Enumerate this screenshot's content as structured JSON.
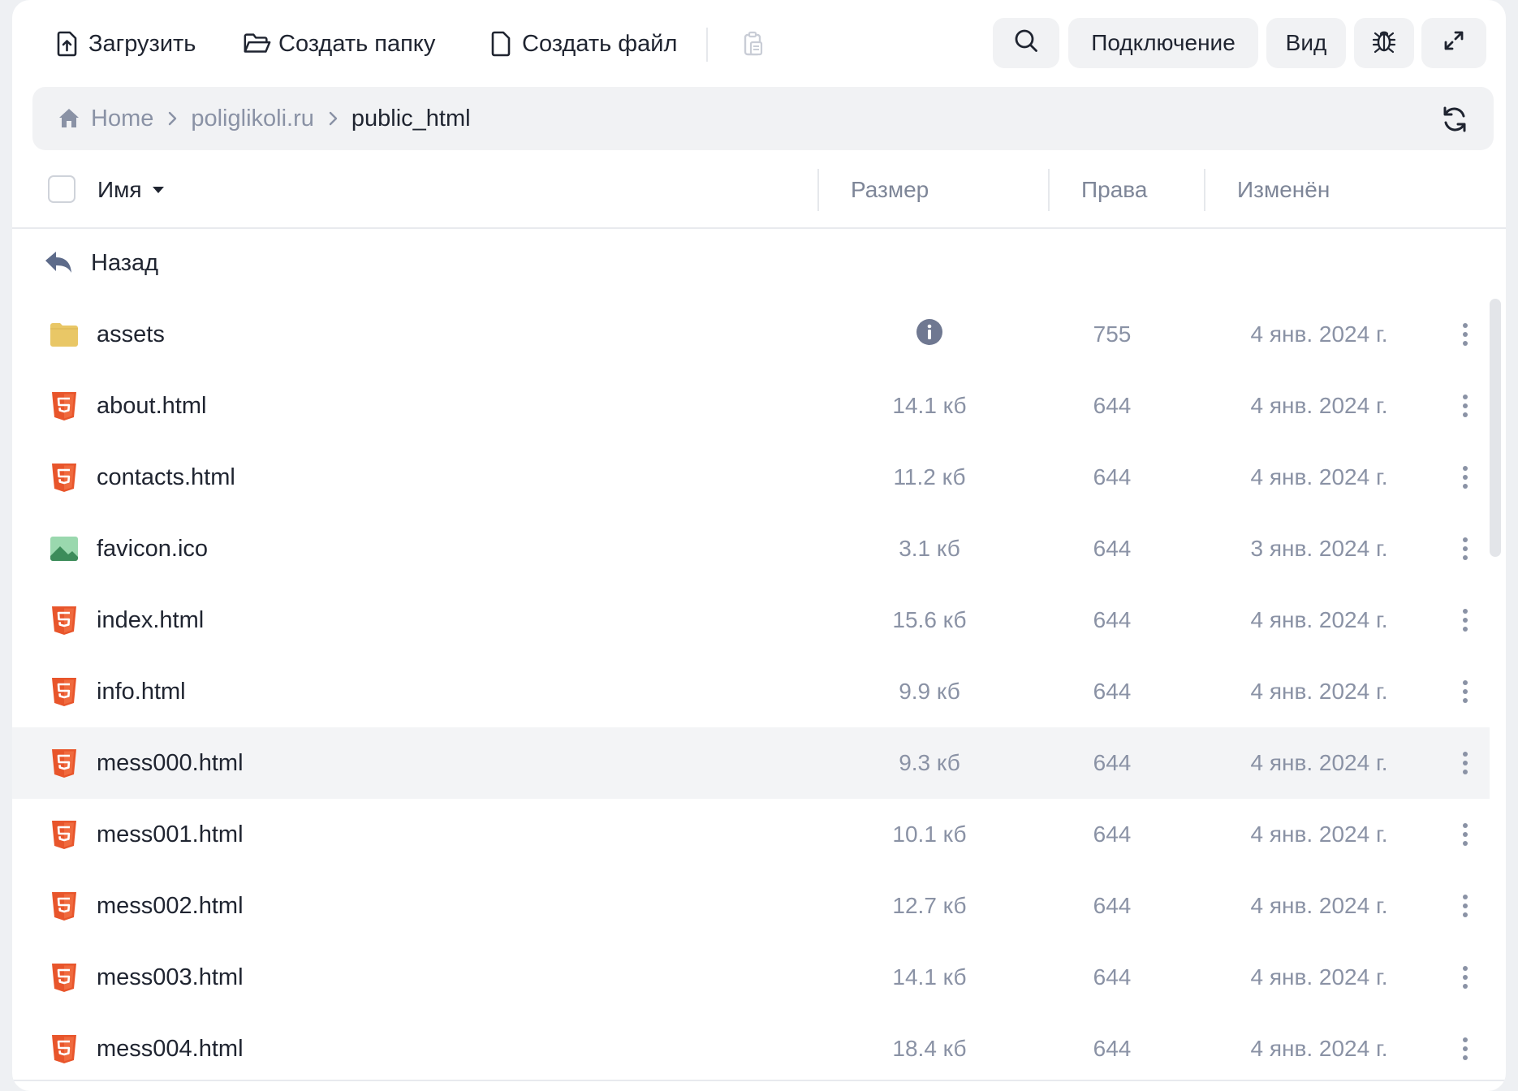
{
  "toolbar": {
    "upload_label": "Загрузить",
    "new_folder_label": "Создать папку",
    "new_file_label": "Создать файл",
    "connection_label": "Подключение",
    "view_label": "Вид"
  },
  "breadcrumb": {
    "items": [
      "Home",
      "poliglikoli.ru",
      "public_html"
    ]
  },
  "table": {
    "columns": {
      "name": "Имя",
      "size": "Размер",
      "perms": "Права",
      "modified": "Изменён"
    },
    "back_label": "Назад",
    "rows": [
      {
        "name": "assets",
        "type": "folder",
        "size": "",
        "perms": "755",
        "modified": "4 янв. 2024 г."
      },
      {
        "name": "about.html",
        "type": "html",
        "size": "14.1 кб",
        "perms": "644",
        "modified": "4 янв. 2024 г."
      },
      {
        "name": "contacts.html",
        "type": "html",
        "size": "11.2 кб",
        "perms": "644",
        "modified": "4 янв. 2024 г."
      },
      {
        "name": "favicon.ico",
        "type": "image",
        "size": "3.1 кб",
        "perms": "644",
        "modified": "3 янв. 2024 г."
      },
      {
        "name": "index.html",
        "type": "html",
        "size": "15.6 кб",
        "perms": "644",
        "modified": "4 янв. 2024 г."
      },
      {
        "name": "info.html",
        "type": "html",
        "size": "9.9 кб",
        "perms": "644",
        "modified": "4 янв. 2024 г."
      },
      {
        "name": "mess000.html",
        "type": "html",
        "size": "9.3 кб",
        "perms": "644",
        "modified": "4 янв. 2024 г.",
        "highlighted": true
      },
      {
        "name": "mess001.html",
        "type": "html",
        "size": "10.1 кб",
        "perms": "644",
        "modified": "4 янв. 2024 г."
      },
      {
        "name": "mess002.html",
        "type": "html",
        "size": "12.7 кб",
        "perms": "644",
        "modified": "4 янв. 2024 г."
      },
      {
        "name": "mess003.html",
        "type": "html",
        "size": "14.1 кб",
        "perms": "644",
        "modified": "4 янв. 2024 г."
      },
      {
        "name": "mess004.html",
        "type": "html",
        "size": "18.4 кб",
        "perms": "644",
        "modified": "4 янв. 2024 г."
      }
    ]
  },
  "colors": {
    "html_icon": "#e8552b",
    "folder_icon": "#e9c766",
    "image_icon": "#3c8c5a",
    "text_muted": "#8a92a5",
    "text_main": "#1f2430"
  }
}
